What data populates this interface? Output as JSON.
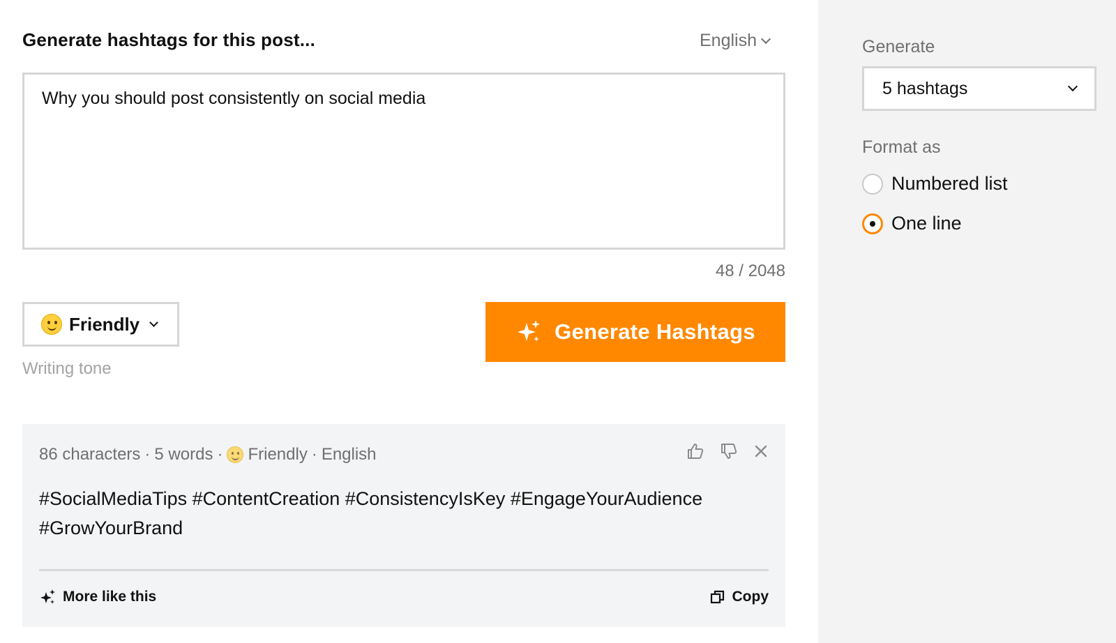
{
  "form": {
    "title": "Generate hashtags for this post...",
    "language": "English",
    "post_text": "Why you should post consistently on social media",
    "char_count": "48 / 2048",
    "tone": {
      "label": "Friendly",
      "icon": "smile-emoji-icon",
      "caption": "Writing tone"
    },
    "generate_button": {
      "label": "Generate Hashtags",
      "icon": "sparkles-icon",
      "color": "#ff8800"
    }
  },
  "result": {
    "meta": {
      "characters": "86 characters",
      "separator": "·",
      "words": "5 words",
      "tone": "Friendly",
      "language": "English"
    },
    "hashtags": "#SocialMediaTips #ContentCreation #ConsistencyIsKey #EngageYourAudience #GrowYourBrand",
    "icons": [
      "thumbs-up-icon",
      "thumbs-down-icon",
      "close-icon"
    ],
    "more_like_this": "More like this",
    "copy": "Copy"
  },
  "settings": {
    "generate_label": "Generate",
    "generate_value": "5 hashtags",
    "format_label": "Format as",
    "format_options": [
      {
        "label": "Numbered list",
        "selected": false
      },
      {
        "label": "One line",
        "selected": true
      }
    ],
    "accent_color": "#ff8800"
  }
}
